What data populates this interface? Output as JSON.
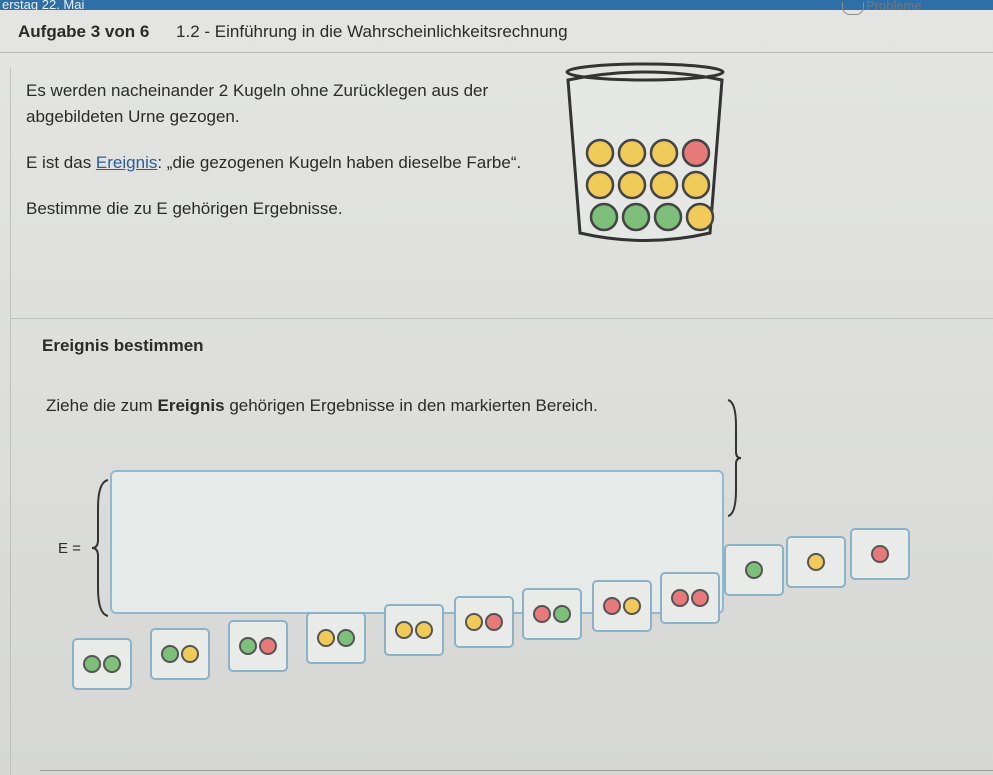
{
  "status_bar": {
    "text": "erstag 22. Mai"
  },
  "header": {
    "task_count": "Aufgabe 3 von 6",
    "title": "1.2 - Einführung in die Wahrscheinlichkeitsrechnung",
    "right_text": "Probleme"
  },
  "task": {
    "p1": "Es werden nacheinander 2 Kugeln ohne Zurücklegen aus der abgebildeten Urne gezogen.",
    "p2_before": "E ist das ",
    "p2_link": "Ereignis",
    "p2_after": ": „die gezogenen Kugeln haben dieselbe Farbe“.",
    "p3": "Bestimme die zu E gehörigen Ergebnisse."
  },
  "urn": {
    "rows": [
      [
        "y",
        "y",
        "y",
        "r"
      ],
      [
        "y",
        "y",
        "y",
        "y"
      ],
      [
        "g",
        "g",
        "g",
        "y"
      ]
    ]
  },
  "section": {
    "title": "Ereignis bestimmen",
    "instr_before": "Ziehe die zum ",
    "instr_bold": "Ereignis",
    "instr_after": " gehörigen Ergebnisse in den markierten Bereich.",
    "e_label": "E ="
  },
  "tiles": [
    [
      "g",
      "g"
    ],
    [
      "g",
      "y"
    ],
    [
      "g",
      "r"
    ],
    [
      "y",
      "g"
    ],
    [
      "y",
      "y"
    ],
    [
      "y",
      "r"
    ],
    [
      "r",
      "g"
    ],
    [
      "r",
      "y"
    ],
    [
      "r",
      "r"
    ],
    [
      "g"
    ],
    [
      "y"
    ],
    [
      "r"
    ]
  ],
  "colors": {
    "green": "#7ec07a",
    "yellow": "#f1cb5a",
    "red": "#e8797a",
    "accent": "#2f6fa8"
  }
}
